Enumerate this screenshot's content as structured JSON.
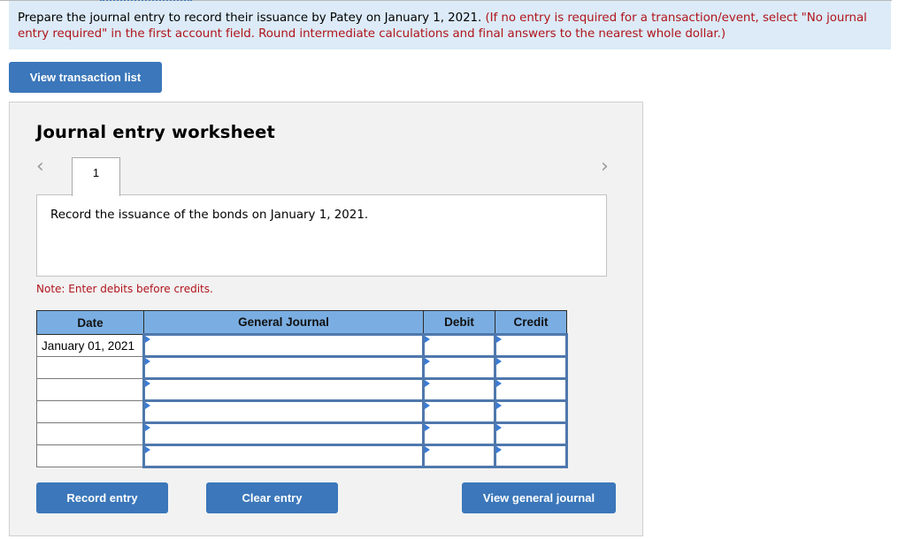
{
  "instructions": {
    "main": "Prepare the journal entry to record their issuance by Patey on January 1, 2021.",
    "note": "(If no entry is required for a transaction/event, select \"No journal entry required\" in the first account field. Round intermediate calculations and final answers to the nearest whole dollar.)"
  },
  "buttons": {
    "view_transaction_list": "View transaction list",
    "record_entry": "Record entry",
    "clear_entry": "Clear entry",
    "view_general_journal": "View general journal"
  },
  "worksheet": {
    "title": "Journal entry worksheet",
    "prev_icon": "‹",
    "next_icon": "›",
    "tabs": [
      "1"
    ],
    "description": "Record the issuance of the bonds on January 1, 2021.",
    "note": "Note: Enter debits before credits."
  },
  "journal": {
    "headers": {
      "date": "Date",
      "general_journal": "General Journal",
      "debit": "Debit",
      "credit": "Credit"
    },
    "rows": [
      {
        "date": "January 01, 2021",
        "account": "",
        "debit": "",
        "credit": ""
      },
      {
        "date": "",
        "account": "",
        "debit": "",
        "credit": ""
      },
      {
        "date": "",
        "account": "",
        "debit": "",
        "credit": ""
      },
      {
        "date": "",
        "account": "",
        "debit": "",
        "credit": ""
      },
      {
        "date": "",
        "account": "",
        "debit": "",
        "credit": ""
      },
      {
        "date": "",
        "account": "",
        "debit": "",
        "credit": ""
      }
    ]
  },
  "colors": {
    "accent": "#3b77ba",
    "header_blue": "#7aaee2",
    "warning_red": "#b0141c",
    "instruction_bg": "#dcebf7"
  }
}
